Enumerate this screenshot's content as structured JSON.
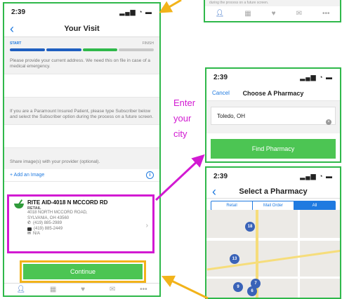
{
  "left_phone": {
    "time": "2:39",
    "title": "Your Visit",
    "progress_start": "START",
    "progress_finish": "FINISH",
    "progress_steps_done": 2,
    "progress_steps_total": 4,
    "address_note": "Please provide your current address. We need this on file in case of a medical emergency.",
    "insurance_note": "If you are a Paramount Insured Patient, please type Subscriber below and select the Subscriber option during the process on a future screen.",
    "share_note": "Share image(s) with your provider (optional).",
    "add_image": "+ Add an Image",
    "pharmacy": {
      "name": "RITE AID-4018 N MCCORD RD",
      "type": "RETAIL",
      "address1": "4018 NORTH MCCORD ROAD,",
      "address2": "SYLVANIA, OH 43560",
      "phone": "(419) 885-2989",
      "fax": "(419) 885-2449",
      "email": "N/A"
    },
    "continue": "Continue"
  },
  "top_snippet": {
    "text": "during the process on a future screen."
  },
  "choose_pharmacy": {
    "time": "2:39",
    "cancel": "Cancel",
    "title": "Choose A Pharmacy",
    "city_value": "Toledo, OH",
    "find_button": "Find Pharmacy"
  },
  "annotation": {
    "enter_city": "Enter your city"
  },
  "select_pharmacy": {
    "time": "2:39",
    "title": "Select a Pharmacy",
    "tabs": [
      "Retail",
      "Mail Order",
      "All"
    ],
    "active_tab": "All",
    "markers": [
      "18",
      "13",
      "9",
      "7",
      "6"
    ]
  },
  "colors": {
    "frame_green": "#2fb84a",
    "highlight_magenta": "#d21ad2",
    "highlight_orange": "#f2b31a",
    "button_green": "#4cc553",
    "link_blue": "#1f7ae0"
  }
}
